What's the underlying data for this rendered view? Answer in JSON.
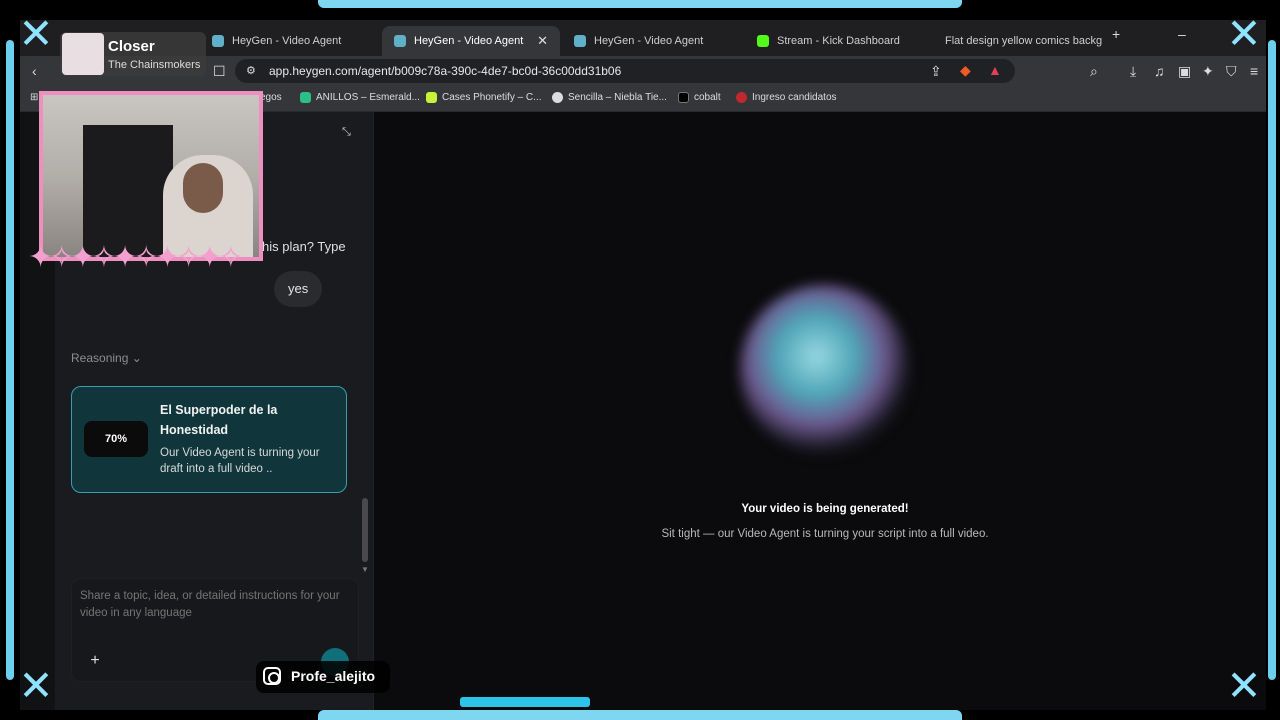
{
  "browser": {
    "tabs": [
      {
        "label": "HeyGen - Video Agent",
        "active": false
      },
      {
        "label": "HeyGen - Video Agent",
        "active": true
      },
      {
        "label": "HeyGen - Video Agent",
        "active": false
      },
      {
        "label": "Stream - Kick Dashboard",
        "active": false
      },
      {
        "label": "Flat design yellow comics backg",
        "active": false
      }
    ],
    "new_tab": "+",
    "url": "app.heygen.com/agent/b009c78a-390c-4de7-bc0d-36c00dd31b06",
    "bookmarks": [
      {
        "label": "egos"
      },
      {
        "label": "ANILLOS – Esmerald..."
      },
      {
        "label": "Cases Phonetify – C..."
      },
      {
        "label": "Sencilla – Niebla Tie..."
      },
      {
        "label": "cobalt"
      },
      {
        "label": "Ingreso candidatos"
      }
    ]
  },
  "chat": {
    "assistant_partial": "his plan? Type",
    "user_message": "yes",
    "reasoning_label": "Reasoning",
    "card": {
      "progress": "70%",
      "title": "El Superpoder de la Honestidad",
      "description": "Our Video Agent is turning your draft into a full video .."
    },
    "composer": {
      "placeholder": "Share a topic, idea, or detailed instructions for your video in any language"
    }
  },
  "main": {
    "status_title": "Your video is being generated!",
    "status_subtitle": "Sit tight — our Video Agent is turning your script into a full video."
  },
  "overlay": {
    "now_playing_title": "Closer",
    "now_playing_artist": "The Chainsmokers",
    "social_handle": "Profe_alejito"
  },
  "colors": {
    "accent_teal": "#3a9eb0",
    "card_bg": "#10363b",
    "frame_cyan": "#7fd6f0",
    "webcam_border": "#ef8fc0"
  }
}
